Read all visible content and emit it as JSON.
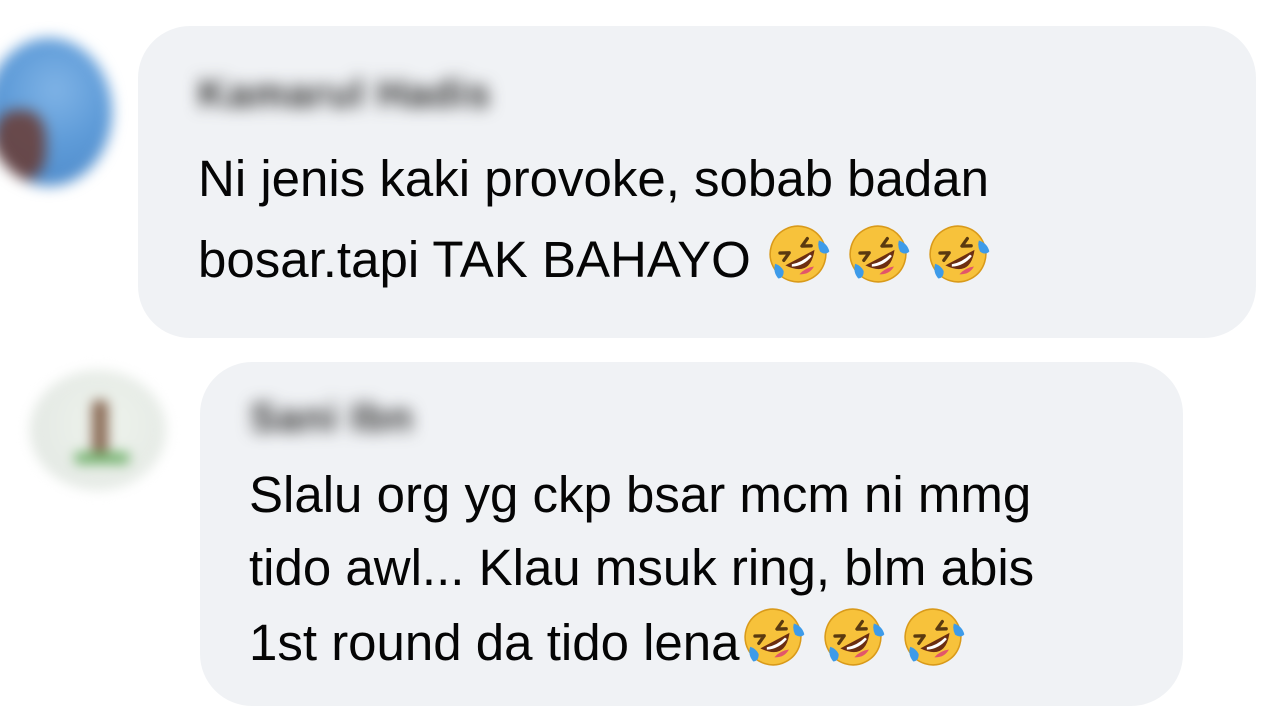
{
  "comments": [
    {
      "author": "Kamarul Hadis",
      "lines": [
        "Ni jenis kaki provoke, sobab badan",
        "bosar.tapi TAK BAHAYO"
      ],
      "emoji": [
        "rolling-on-floor-laughing",
        "rolling-on-floor-laughing",
        "rolling-on-floor-laughing"
      ]
    },
    {
      "author": "Sani Ibn",
      "lines": [
        "Slalu org yg ckp bsar mcm ni mmg",
        "tido awl... Klau msuk ring, blm abis",
        "1st round da tido lena"
      ],
      "emoji": [
        "rolling-on-floor-laughing",
        "rolling-on-floor-laughing",
        "rolling-on-floor-laughing"
      ]
    }
  ],
  "colors": {
    "bubble": "#f0f2f5",
    "text": "#050505",
    "emoji_face": "#f7c23b",
    "emoji_tear": "#3d9be9"
  }
}
